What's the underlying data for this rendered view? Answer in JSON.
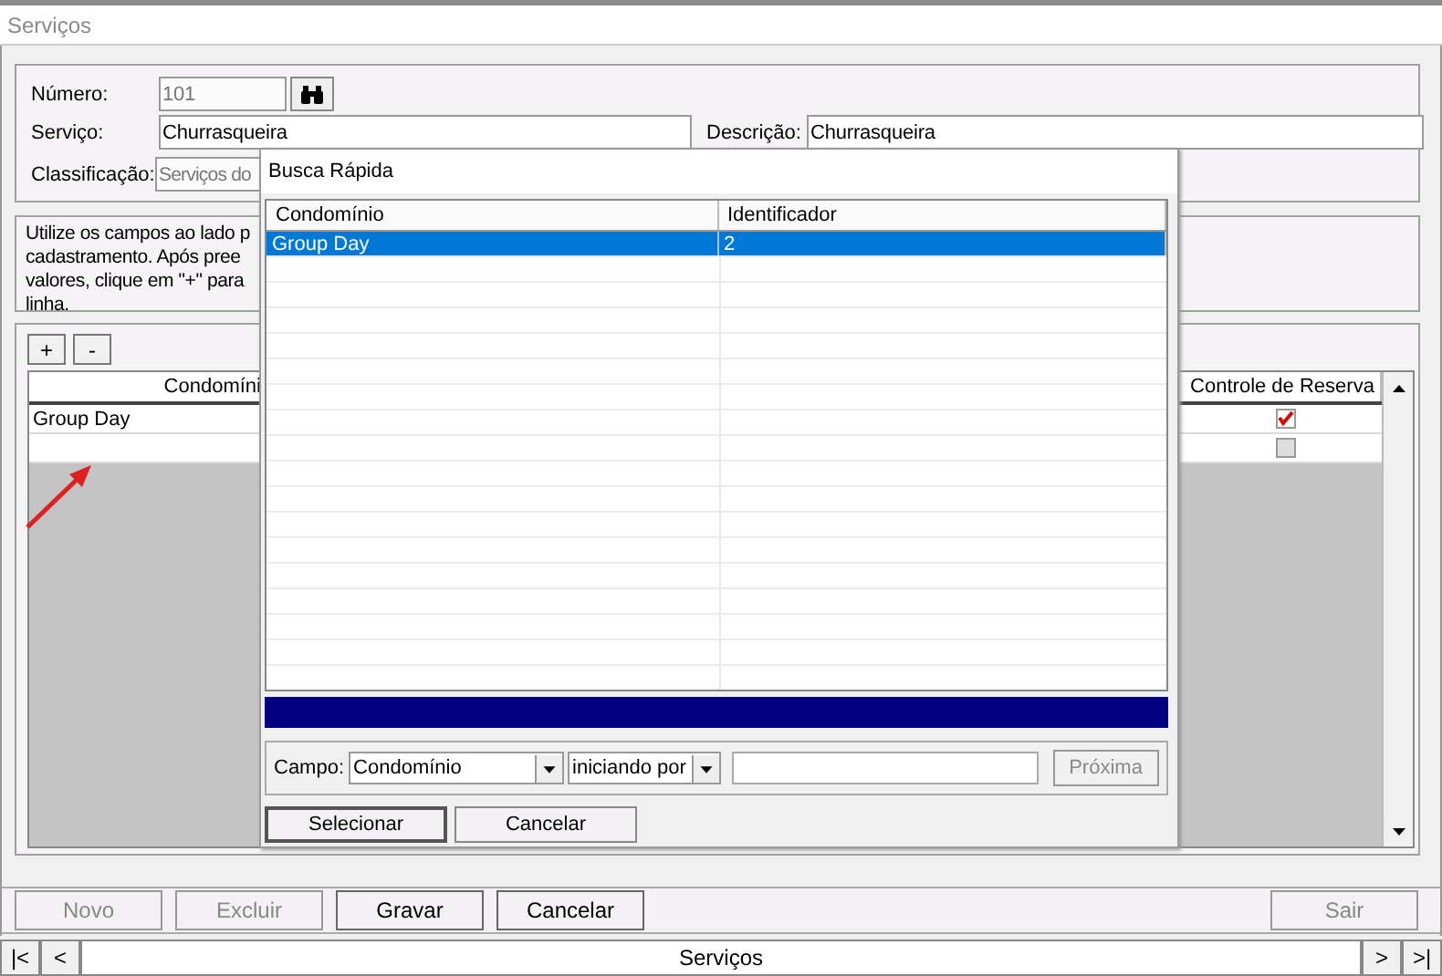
{
  "window": {
    "title": "Serviços"
  },
  "form": {
    "numero": {
      "label": "Número:",
      "value": "101",
      "disabled": true
    },
    "servico": {
      "label": "Serviço:",
      "value": "Churrasqueira",
      "disabled": false
    },
    "descricao": {
      "label": "Descrição:",
      "value": "Churrasqueira",
      "disabled": false
    },
    "classificacao": {
      "label": "Classificação:",
      "value": "Serviços do",
      "disabled": true
    }
  },
  "hint_lines": [
    "Utilize os campos ao lado p",
    "cadastramento. Após pree",
    "valores, clique em \"+\" para",
    "linha."
  ],
  "grid_buttons": [
    "+",
    "-"
  ],
  "grid": {
    "columns": [
      "Condomíni",
      "Controle de Reserva"
    ],
    "rows": [
      {
        "condominio": "Group Day",
        "reserva": true
      },
      {
        "reserva": false
      }
    ]
  },
  "buttons": [
    {
      "label": "Novo",
      "disabled": true
    },
    {
      "label": "Excluir",
      "disabled": true
    },
    {
      "label": "Gravar",
      "disabled": false
    },
    {
      "label": "Cancelar",
      "disabled": false
    },
    {
      "label": "Sair",
      "disabled": true
    }
  ],
  "nav": {
    "first": "|<",
    "prev": "<",
    "title": "Serviços",
    "next": ">",
    "last": ">|"
  },
  "dialog": {
    "title": "Busca Rápida",
    "columns": [
      "Condomínio",
      "Identificador"
    ],
    "rows": [
      {
        "condominio": "Group Day",
        "identificador": "2",
        "selected": true
      }
    ],
    "campo_label": "Campo:",
    "campo_value": "Condomínio",
    "mode_value": "iniciando por",
    "next_button": {
      "label": "Próxima",
      "disabled": true
    },
    "buttons": [
      {
        "label": "Selecionar",
        "default": true
      },
      {
        "label": "Cancelar",
        "default": false
      }
    ]
  }
}
